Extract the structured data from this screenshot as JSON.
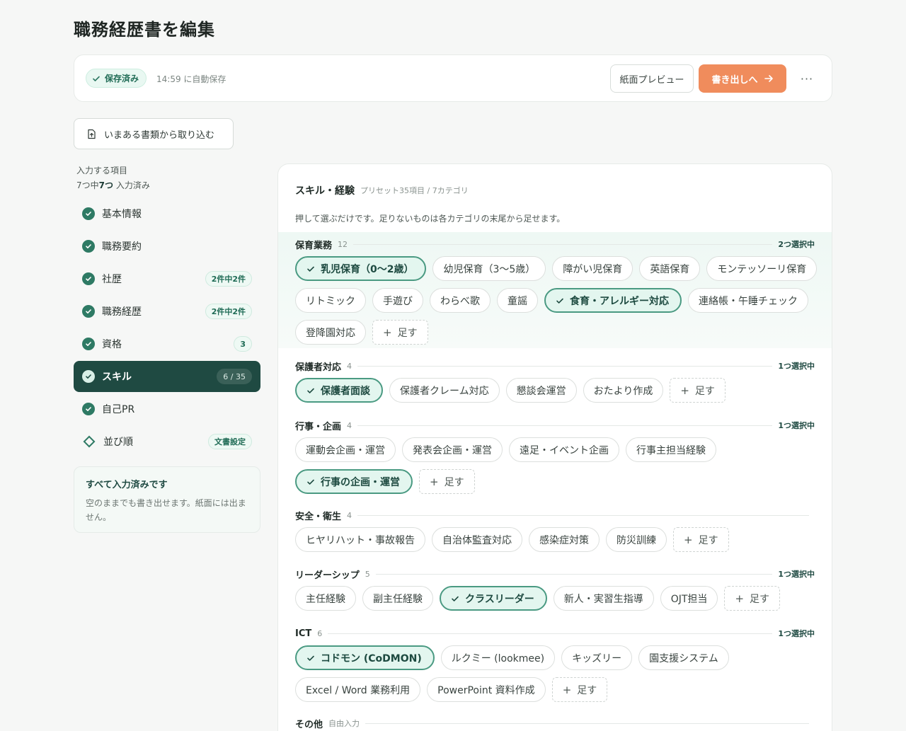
{
  "page": {
    "title": "職務経歴書を編集"
  },
  "toolbar": {
    "saved_label": "保存済み",
    "autosave_text": "14:59 に自動保存",
    "preview_label": "紙面プレビュー",
    "export_label": "書き出しへ",
    "more_label": "···",
    "accent_color": "#f08c5c"
  },
  "import_button": {
    "label": "いまある書類から取り込む"
  },
  "sidebar": {
    "section_label": "入力する項目",
    "progress_prefix": "7つ中",
    "progress_value": "7つ",
    "progress_suffix": " 入力済み",
    "items": [
      {
        "label": "基本情報",
        "status": "done",
        "count": ""
      },
      {
        "label": "職務要約",
        "status": "done",
        "count": ""
      },
      {
        "label": "社歴",
        "status": "done",
        "count": "2件中2件"
      },
      {
        "label": "職務経歴",
        "status": "done",
        "count": "2件中2件"
      },
      {
        "label": "資格",
        "status": "done",
        "count": "3"
      },
      {
        "label": "スキル",
        "status": "done",
        "count": "6 / 35",
        "active": true
      },
      {
        "label": "自己PR",
        "status": "done",
        "count": ""
      },
      {
        "label": "並び順",
        "status": "settings",
        "count": "文書設定"
      }
    ],
    "done_box": {
      "title": "すべて入力済みです",
      "text": "空のままでも書き出せます。紙面には出ません。"
    }
  },
  "skills": {
    "title": "スキル・経験",
    "subtitle": "プリセット35項目 / 7カテゴリ",
    "description": "押して選ぶだけです。足りないものは各カテゴリの末尾から足せます。",
    "add_label": "足す",
    "categories": [
      {
        "name": "保育業務",
        "count": "12",
        "selected_label": "2つ選択中",
        "chips": [
          {
            "label": "乳児保育（0〜2歳）",
            "selected": true
          },
          {
            "label": "幼児保育（3〜5歳）",
            "selected": false
          },
          {
            "label": "障がい児保育",
            "selected": false
          },
          {
            "label": "英語保育",
            "selected": false
          },
          {
            "label": "モンテッソーリ保育",
            "selected": false
          },
          {
            "label": "リトミック",
            "selected": false
          },
          {
            "label": "手遊び",
            "selected": false
          },
          {
            "label": "わらべ歌",
            "selected": false
          },
          {
            "label": "童謡",
            "selected": false
          },
          {
            "label": "食育・アレルギー対応",
            "selected": true
          },
          {
            "label": "連絡帳・午睡チェック",
            "selected": false
          },
          {
            "label": "登降園対応",
            "selected": false
          }
        ]
      },
      {
        "name": "保護者対応",
        "count": "4",
        "selected_label": "1つ選択中",
        "chips": [
          {
            "label": "保護者面談",
            "selected": true
          },
          {
            "label": "保護者クレーム対応",
            "selected": false
          },
          {
            "label": "懇談会運営",
            "selected": false
          },
          {
            "label": "おたより作成",
            "selected": false
          }
        ]
      },
      {
        "name": "行事・企画",
        "count": "4",
        "selected_label": "1つ選択中",
        "chips": [
          {
            "label": "運動会企画・運営",
            "selected": false
          },
          {
            "label": "発表会企画・運営",
            "selected": false
          },
          {
            "label": "遠足・イベント企画",
            "selected": false
          },
          {
            "label": "行事主担当経験",
            "selected": false
          },
          {
            "label": "行事の企画・運営",
            "selected": true
          }
        ]
      },
      {
        "name": "安全・衛生",
        "count": "4",
        "selected_label": "",
        "chips": [
          {
            "label": "ヒヤリハット・事故報告",
            "selected": false
          },
          {
            "label": "自治体監査対応",
            "selected": false
          },
          {
            "label": "感染症対策",
            "selected": false
          },
          {
            "label": "防災訓練",
            "selected": false
          }
        ]
      },
      {
        "name": "リーダーシップ",
        "count": "5",
        "selected_label": "1つ選択中",
        "chips": [
          {
            "label": "主任経験",
            "selected": false
          },
          {
            "label": "副主任経験",
            "selected": false
          },
          {
            "label": "クラスリーダー",
            "selected": true
          },
          {
            "label": "新人・実習生指導",
            "selected": false
          },
          {
            "label": "OJT担当",
            "selected": false
          }
        ]
      },
      {
        "name": "ICT",
        "count": "6",
        "selected_label": "1つ選択中",
        "chips": [
          {
            "label": "コドモン (CoDMON)",
            "selected": true
          },
          {
            "label": "ルクミー (lookmee)",
            "selected": false
          },
          {
            "label": "キッズリー",
            "selected": false
          },
          {
            "label": "園支援システム",
            "selected": false
          },
          {
            "label": "Excel / Word 業務利用",
            "selected": false
          },
          {
            "label": "PowerPoint 資料作成",
            "selected": false
          }
        ]
      },
      {
        "name": "その他",
        "count": "自由入力",
        "selected_label": "",
        "chips": []
      }
    ]
  }
}
